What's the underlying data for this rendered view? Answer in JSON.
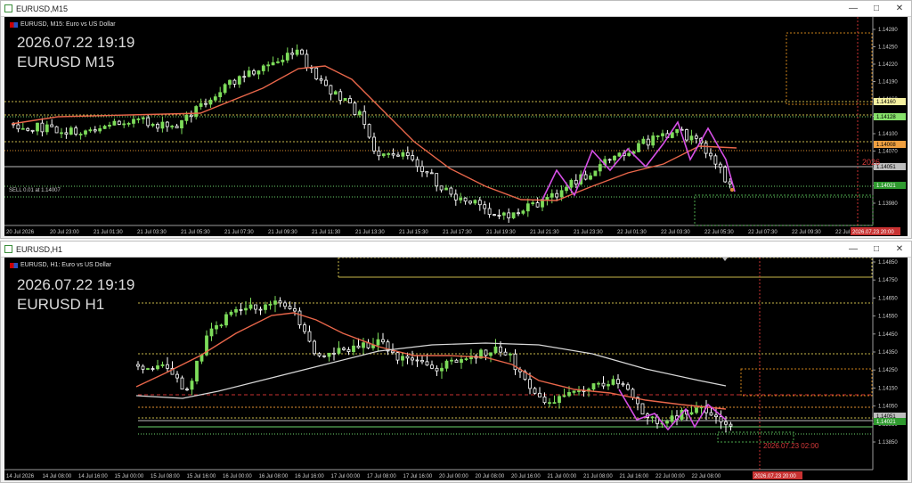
{
  "top": {
    "window_title": "EURUSD,M15",
    "symbol_line": "EURUSD, M15: Euro vs US Dollar",
    "info_date": "2026.07.22 19:19",
    "info_symbol": "EURUSD M15",
    "sell_label": "SELL 0.01 at 1.14007",
    "red_text": "2026",
    "price_ticks": [
      "1.14280",
      "1.14250",
      "1.14220",
      "1.14190",
      "1.14160",
      "1.14130",
      "1.14100",
      "1.14070",
      "1.14040",
      "1.14010",
      "1.13980"
    ],
    "price_tags": [
      {
        "text": "1.14160",
        "bg": "#f5f0a0",
        "fg": "#000"
      },
      {
        "text": "1.14128",
        "bg": "#86e06a",
        "fg": "#000"
      },
      {
        "text": "1.14008",
        "bg": "#f0a040",
        "fg": "#000"
      },
      {
        "text": "1.14051",
        "bg": "#bdbdbd",
        "fg": "#000"
      },
      {
        "text": "1.14021",
        "bg": "#2f9a2f",
        "fg": "#fff"
      }
    ],
    "time_ticks": [
      "20 Jul 2026",
      "20 Jul 23:00",
      "21 Jul 01:30",
      "21 Jul 03:30",
      "21 Jul 05:30",
      "21 Jul 07:30",
      "21 Jul 09:30",
      "21 Jul 11:30",
      "21 Jul 13:30",
      "21 Jul 15:30",
      "21 Jul 17:30",
      "21 Jul 19:30",
      "21 Jul 21:30",
      "21 Jul 23:30",
      "22 Jul 01:30",
      "22 Jul 03:30",
      "22 Jul 05:30",
      "22 Jul 07:30",
      "22 Jul 09:30",
      "22 Jul 11:30"
    ],
    "time_tag": "2026.07.23 20:00"
  },
  "bottom": {
    "window_title": "EURUSD,H1",
    "symbol_line": "EURUSD, H1: Euro vs US Dollar",
    "info_date": "2026.07.22 19:19",
    "info_symbol": "EURUSD H1",
    "red_text": "2026.07.23 02:00",
    "price_ticks": [
      "1.14850",
      "1.14750",
      "1.14650",
      "1.14550",
      "1.14450",
      "1.14350",
      "1.14250",
      "1.14150",
      "1.14050",
      "1.13950",
      "1.13850"
    ],
    "price_tags": [
      {
        "text": "1.14051",
        "bg": "#bdbdbd",
        "fg": "#000"
      },
      {
        "text": "1.14021",
        "bg": "#2f9a2f",
        "fg": "#fff"
      }
    ],
    "time_ticks": [
      "14 Jul 2026",
      "14 Jul 08:00",
      "14 Jul 16:00",
      "15 Jul 00:00",
      "15 Jul 08:00",
      "15 Jul 16:00",
      "16 Jul 00:00",
      "16 Jul 08:00",
      "16 Jul 16:00",
      "17 Jul 00:00",
      "17 Jul 08:00",
      "17 Jul 16:00",
      "20 Jul 00:00",
      "20 Jul 08:00",
      "20 Jul 16:00",
      "21 Jul 00:00",
      "21 Jul 08:00",
      "21 Jul 16:00",
      "22 Jul 00:00",
      "22 Jul 08:00"
    ],
    "time_tag": "2026.07.23 20:00"
  },
  "colors": {
    "bull": "#7ddc5a",
    "bear": "#ffffff",
    "ema": "#e8664a",
    "sma": "#d8d8d8",
    "zigzag": "#d64fe6",
    "grid": "#1e1e1e"
  },
  "icons": {
    "window_icon": "chart-window-icon",
    "minimize": "minimize-icon",
    "maximize": "maximize-icon",
    "close": "close-icon"
  }
}
